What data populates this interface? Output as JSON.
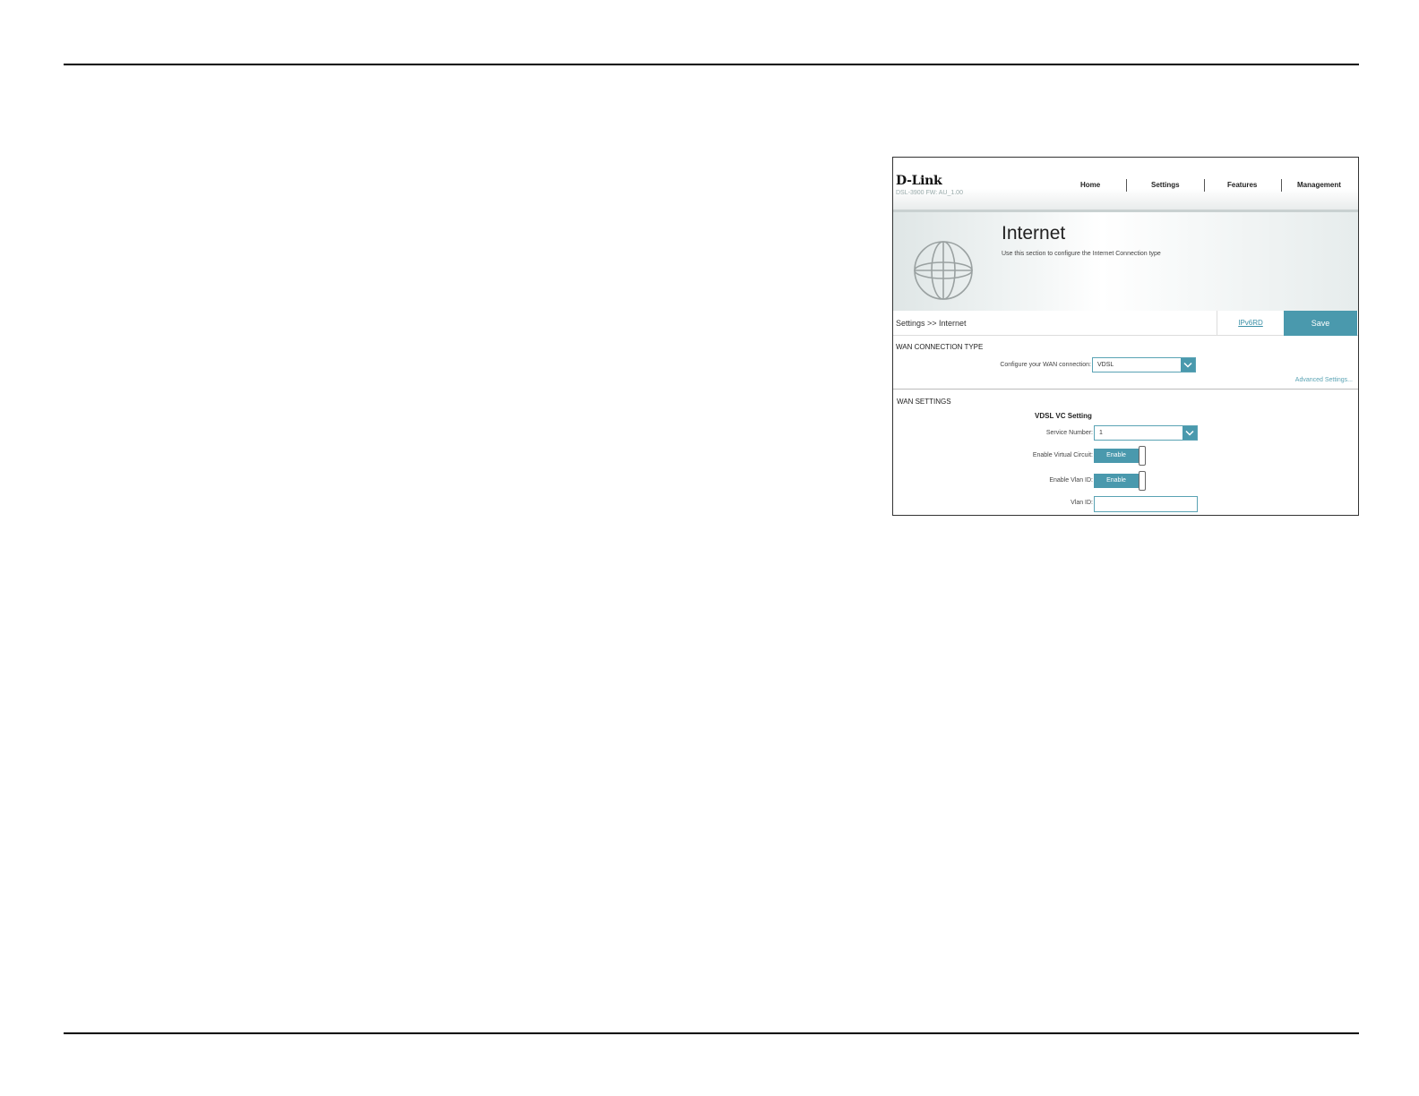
{
  "brand": {
    "logo": "D-Link",
    "model": "DSL-3900   FW: AU_1.00"
  },
  "nav": {
    "items": [
      "Home",
      "Settings",
      "Features",
      "Management"
    ]
  },
  "banner": {
    "title": "Internet",
    "description": "Use this section to configure the Internet Connection type"
  },
  "toolbar": {
    "breadcrumb": "Settings >> Internet",
    "ipv6_link": "IPv6RD",
    "save_label": "Save"
  },
  "wan_connection": {
    "section_title": "WAN CONNECTION TYPE",
    "label": "Configure your WAN connection:",
    "value": "VDSL",
    "advanced_link": "Advanced Settings..."
  },
  "wan_settings": {
    "section_title": "WAN SETTINGS",
    "subheading": "VDSL VC Setting",
    "service_number_label": "Service Number:",
    "service_number_value": "1",
    "virtual_circuit_label": "Enable Virtual Circuit:",
    "virtual_circuit_state": "Enable",
    "vlan_enable_label": "Enable Vlan ID:",
    "vlan_enable_state": "Enable",
    "vlan_id_label": "Vlan ID:",
    "vlan_id_value": ""
  },
  "colors": {
    "accent": "#4a99ad",
    "link": "#3a8fa6"
  }
}
